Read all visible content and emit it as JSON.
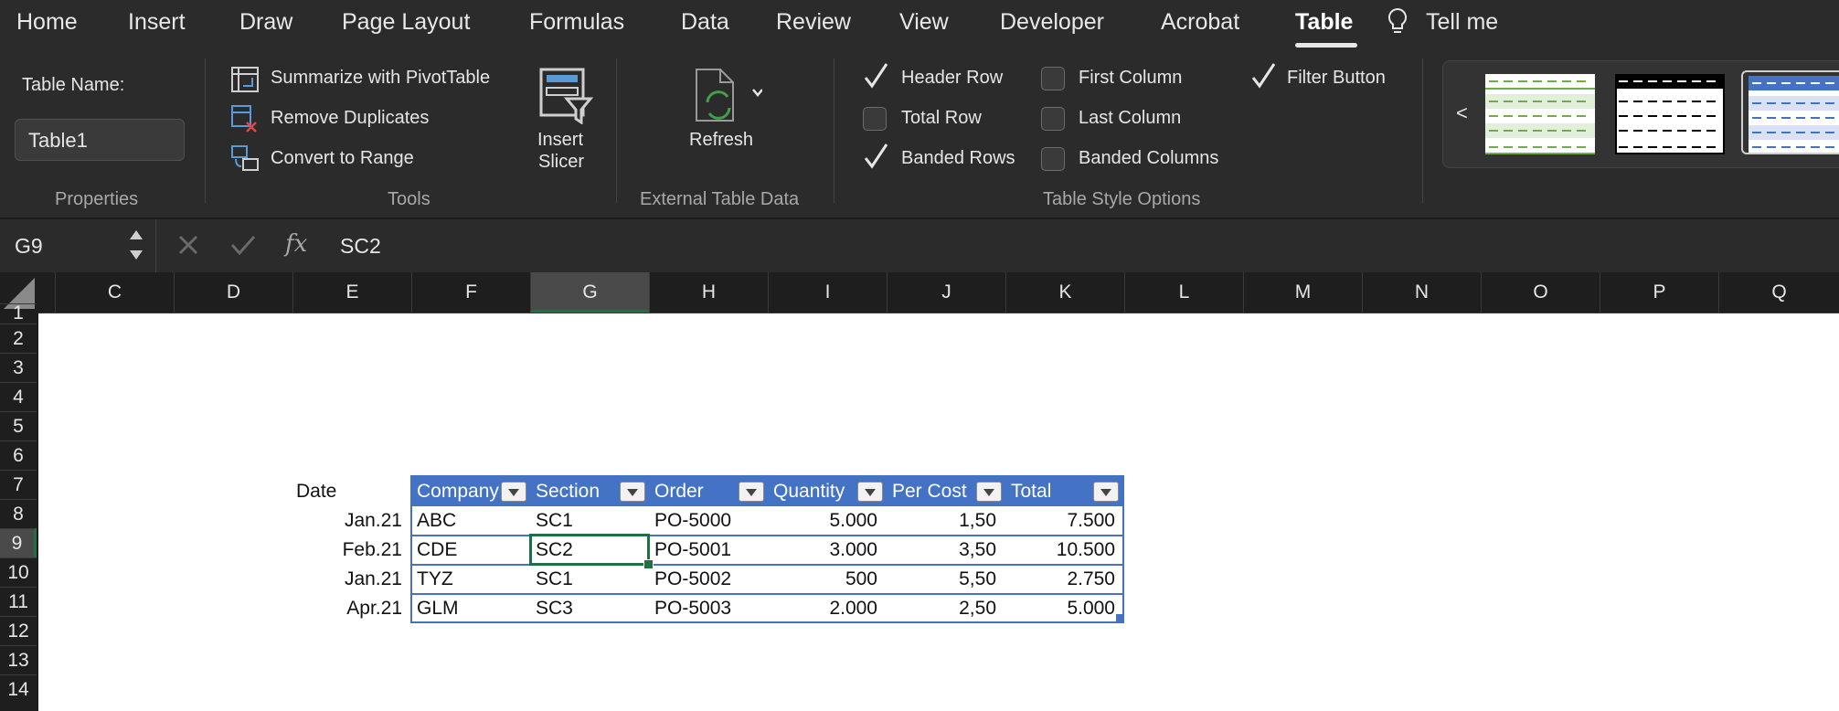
{
  "ribbon": {
    "tabs": [
      "Home",
      "Insert",
      "Draw",
      "Page Layout",
      "Formulas",
      "Data",
      "Review",
      "View",
      "Developer",
      "Acrobat",
      "Table"
    ],
    "active_tab": "Table",
    "tell_me": "Tell me",
    "properties": {
      "table_name_label": "Table Name:",
      "table_name_value": "Table1",
      "group": "Properties"
    },
    "tools": {
      "summarize": "Summarize with PivotTable",
      "remove_duplicates": "Remove Duplicates",
      "convert": "Convert to Range",
      "insert_slicer_1": "Insert",
      "insert_slicer_2": "Slicer",
      "group": "Tools"
    },
    "external": {
      "refresh": "Refresh",
      "group": "External Table Data"
    },
    "style_options": {
      "header_row": "Header Row",
      "total_row": "Total Row",
      "banded_rows": "Banded Rows",
      "first_column": "First Column",
      "last_column": "Last Column",
      "banded_columns": "Banded Columns",
      "filter_button": "Filter Button",
      "group": "Table Style Options",
      "checked": {
        "header_row": true,
        "total_row": false,
        "banded_rows": true,
        "first_column": false,
        "last_column": false,
        "banded_columns": false,
        "filter_button": true
      }
    },
    "gallery": {
      "prev": "<",
      "styles": [
        "green-dashed-style",
        "black-dashed-style",
        "blue-dashed-style"
      ]
    }
  },
  "formula_bar": {
    "cell_ref": "G9",
    "fx": "fx",
    "value": "SC2"
  },
  "columns": [
    "C",
    "D",
    "E",
    "F",
    "G",
    "H",
    "I",
    "J",
    "K",
    "L",
    "M",
    "N",
    "O",
    "P",
    "Q"
  ],
  "selected_column": "G",
  "rows": [
    "1",
    "2",
    "3",
    "4",
    "5",
    "6",
    "7",
    "8",
    "9",
    "10",
    "11",
    "12",
    "13",
    "14"
  ],
  "selected_row": "9",
  "sheet": {
    "date_label": "Date",
    "dates": [
      "Jan.21",
      "Feb.21",
      "Jan.21",
      "Apr.21"
    ],
    "table_headers": [
      "Company",
      "Section",
      "Order",
      "Quantity",
      "Per Cost",
      "Total"
    ],
    "table_rows": [
      [
        "ABC",
        "SC1",
        "PO-5000",
        "5.000",
        "1,50",
        "7.500"
      ],
      [
        "CDE",
        "SC2",
        "PO-5001",
        "3.000",
        "3,50",
        "10.500"
      ],
      [
        "TYZ",
        "SC1",
        "PO-5002",
        "500",
        "5,50",
        "2.750"
      ],
      [
        "GLM",
        "SC3",
        "PO-5003",
        "2.000",
        "2,50",
        "5.000"
      ]
    ]
  },
  "colors": {
    "table_header": "#4472c4",
    "table_border": "#4472c4",
    "selection": "#1e7145",
    "ribbon_bg": "#2b2b2b"
  }
}
